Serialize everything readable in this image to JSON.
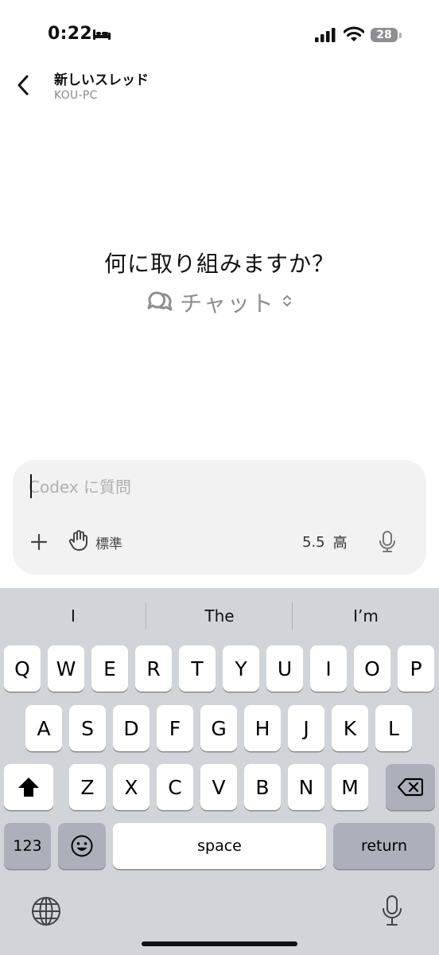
{
  "status_bar": {
    "time": "0:22",
    "battery": "28",
    "icons": [
      "bed-icon",
      "cellular-signal-icon",
      "wifi-icon",
      "battery-icon"
    ]
  },
  "header": {
    "title": "新しいスレッド",
    "subtitle": "KOU-PC",
    "back_icon": "chevron-left-icon"
  },
  "empty_state": {
    "heading": "何に取り組みますか？",
    "mode_label": "チャット",
    "mode_icon": "chat-bubbles-icon",
    "mode_chevron_icon": "chevron-up-down-icon"
  },
  "composer": {
    "placeholder": "Codex に質問",
    "value": "",
    "plus_icon": "plus-icon",
    "permission_icon": "hand-icon",
    "permission_label": "標準",
    "model_version": "5.5",
    "reasoning_level": "高",
    "mic_icon": "microphone-icon"
  },
  "keyboard": {
    "suggestions": [
      "I",
      "The",
      "I’m"
    ],
    "rows": [
      [
        "Q",
        "W",
        "E",
        "R",
        "T",
        "Y",
        "U",
        "I",
        "O",
        "P"
      ],
      [
        "A",
        "S",
        "D",
        "F",
        "G",
        "H",
        "J",
        "K",
        "L"
      ],
      [
        "Z",
        "X",
        "C",
        "V",
        "B",
        "N",
        "M"
      ]
    ],
    "numbers_label": "123",
    "space_label": "space",
    "return_label": "return",
    "shift_icon": "shift-icon",
    "delete_icon": "backspace-icon",
    "emoji_icon": "emoji-icon",
    "globe_icon": "globe-icon",
    "dictation_icon": "microphone-icon"
  },
  "colors": {
    "composer_bg": "#f2f2f2",
    "keyboard_bg": "#d1d4d9",
    "key_bg": "#ffffff",
    "function_key_bg": "#abb0ba",
    "muted_text": "#8e8e93"
  }
}
